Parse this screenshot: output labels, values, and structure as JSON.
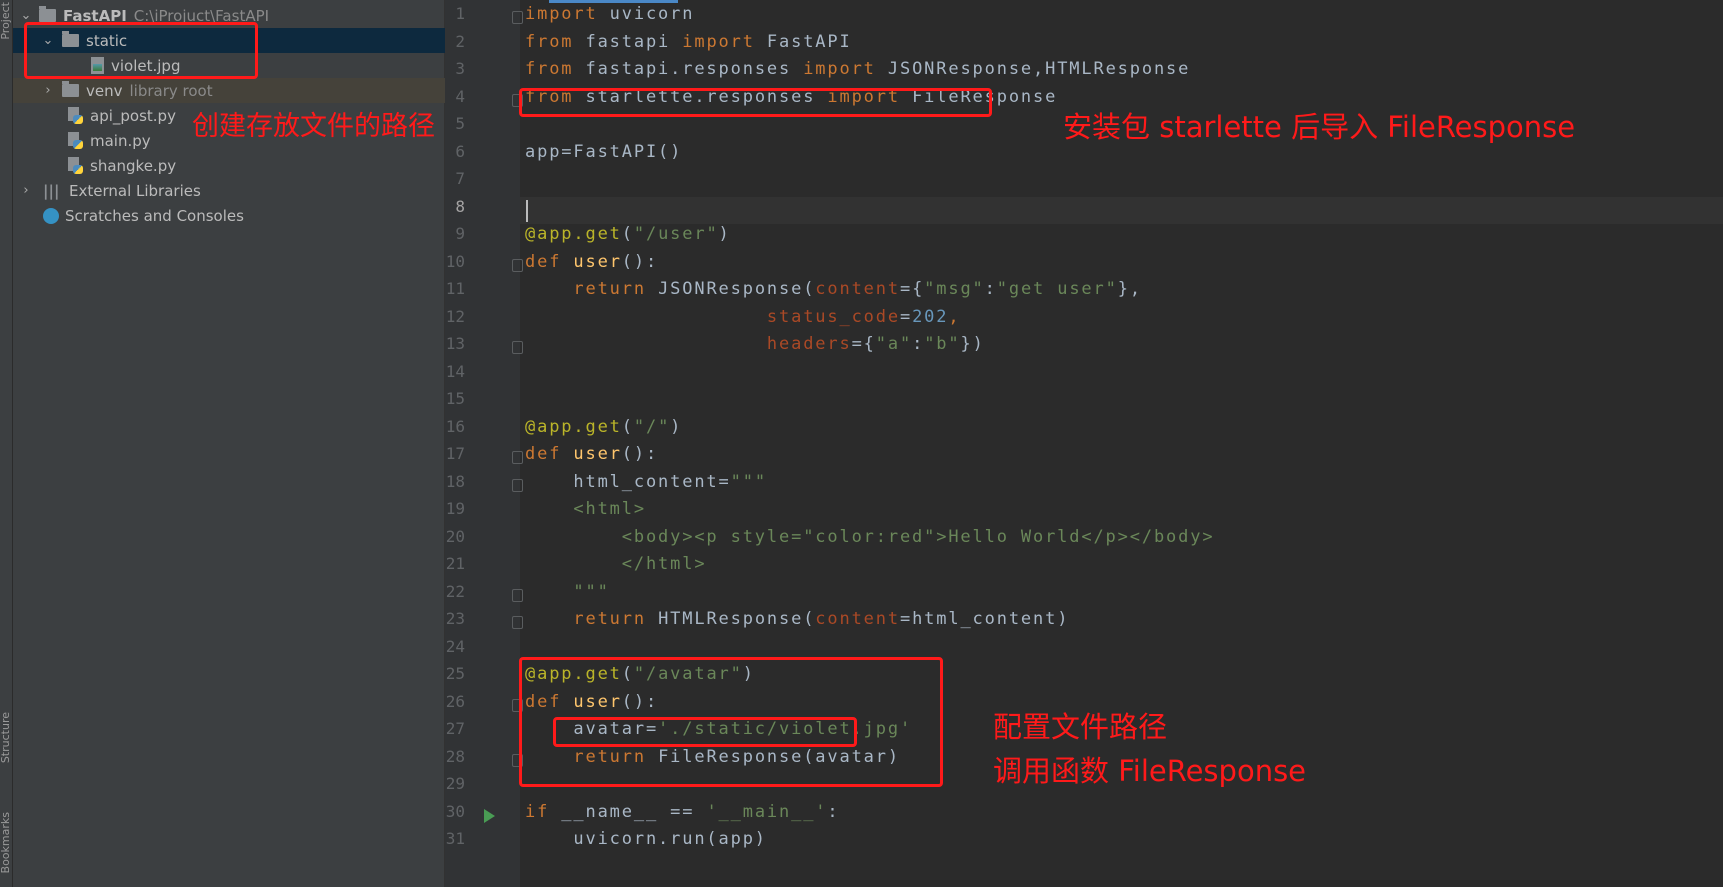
{
  "side_strip": {
    "top_label": "Project",
    "structure_label": "Structure",
    "bookmarks_label": "Bookmarks"
  },
  "project_tree": {
    "root": {
      "name": "FastAPI",
      "path": "C:\\iProjuct\\FastAPI"
    },
    "items": [
      {
        "name": "static",
        "type": "folder",
        "expanded": true
      },
      {
        "name": "violet.jpg",
        "type": "image"
      },
      {
        "name": "venv",
        "type": "folder",
        "hint": "library root"
      },
      {
        "name": "api_post.py",
        "type": "python"
      },
      {
        "name": "main.py",
        "type": "python"
      },
      {
        "name": "shangke.py",
        "type": "python"
      },
      {
        "name": "External Libraries",
        "type": "libraries"
      },
      {
        "name": "Scratches and Consoles",
        "type": "scratches"
      }
    ]
  },
  "editor": {
    "current_line": 8,
    "lines": [
      [
        [
          "kw",
          "import"
        ],
        [
          "pl",
          " uvicorn"
        ]
      ],
      [
        [
          "kw",
          "from"
        ],
        [
          "pl",
          " fastapi "
        ],
        [
          "kw",
          "import"
        ],
        [
          "pl",
          " FastAPI"
        ]
      ],
      [
        [
          "kw",
          "from"
        ],
        [
          "pl",
          " fastapi.responses "
        ],
        [
          "kw",
          "import"
        ],
        [
          "pl",
          " JSONResponse,HTMLResponse"
        ]
      ],
      [
        [
          "kw",
          "from"
        ],
        [
          "pl",
          " starlette.responses "
        ],
        [
          "kw",
          "import"
        ],
        [
          "pl",
          " FileResponse"
        ]
      ],
      [],
      [
        [
          "pl",
          "app=FastAPI()"
        ]
      ],
      [],
      [],
      [
        [
          "deco",
          "@app.get"
        ],
        [
          "pl",
          "("
        ],
        [
          "str",
          "\"/user\""
        ],
        [
          "pl",
          ")"
        ]
      ],
      [
        [
          "kw",
          "def"
        ],
        [
          "pl",
          " "
        ],
        [
          "fn",
          "user"
        ],
        [
          "pl",
          "():"
        ]
      ],
      [
        [
          "pl",
          "    "
        ],
        [
          "kw",
          "return"
        ],
        [
          "pl",
          " JSONResponse("
        ],
        [
          "param",
          "content"
        ],
        [
          "pl",
          "={"
        ],
        [
          "str",
          "\"msg\""
        ],
        [
          "pl",
          ":"
        ],
        [
          "str",
          "\"get user\""
        ],
        [
          "pl",
          "},"
        ]
      ],
      [
        [
          "pl",
          "                    "
        ],
        [
          "param",
          "status_code"
        ],
        [
          "pl",
          "="
        ],
        [
          "num",
          "202"
        ],
        [
          "kw",
          ","
        ]
      ],
      [
        [
          "pl",
          "                    "
        ],
        [
          "param",
          "headers"
        ],
        [
          "pl",
          "={"
        ],
        [
          "str",
          "\"a\""
        ],
        [
          "pl",
          ":"
        ],
        [
          "str",
          "\"b\""
        ],
        [
          "pl",
          "})"
        ]
      ],
      [],
      [],
      [
        [
          "deco",
          "@app.get"
        ],
        [
          "pl",
          "("
        ],
        [
          "str",
          "\"/\""
        ],
        [
          "pl",
          ")"
        ]
      ],
      [
        [
          "kw",
          "def"
        ],
        [
          "pl",
          " "
        ],
        [
          "fn",
          "user"
        ],
        [
          "pl",
          "():"
        ]
      ],
      [
        [
          "pl",
          "    html_content="
        ],
        [
          "str",
          "\"\"\""
        ]
      ],
      [
        [
          "pl",
          "    "
        ],
        [
          "str",
          "<html>"
        ]
      ],
      [
        [
          "pl",
          "        "
        ],
        [
          "str",
          "<body><p style=\"color:red\">Hello World</p></body>"
        ]
      ],
      [
        [
          "pl",
          "        "
        ],
        [
          "str",
          "</html>"
        ]
      ],
      [
        [
          "pl",
          "    "
        ],
        [
          "str",
          "\"\"\""
        ]
      ],
      [
        [
          "pl",
          "    "
        ],
        [
          "kw",
          "return"
        ],
        [
          "pl",
          " HTMLResponse("
        ],
        [
          "param",
          "content"
        ],
        [
          "pl",
          "=html_content)"
        ]
      ],
      [],
      [
        [
          "deco",
          "@app.get"
        ],
        [
          "pl",
          "("
        ],
        [
          "str",
          "\"/avatar\""
        ],
        [
          "pl",
          ")"
        ]
      ],
      [
        [
          "kw",
          "def"
        ],
        [
          "pl",
          " "
        ],
        [
          "fn",
          "user"
        ],
        [
          "pl",
          "():"
        ]
      ],
      [
        [
          "pl",
          "    avatar="
        ],
        [
          "str",
          "'./static/violet.jpg'"
        ]
      ],
      [
        [
          "pl",
          "    "
        ],
        [
          "kw",
          "return"
        ],
        [
          "pl",
          " FileResponse(avatar)"
        ]
      ],
      [],
      [
        [
          "kw",
          "if"
        ],
        [
          "pl",
          " __name__ == "
        ],
        [
          "str",
          "'__main__'"
        ],
        [
          "pl",
          ":"
        ]
      ],
      [
        [
          "pl",
          "    uvicorn.run(app)"
        ]
      ]
    ]
  },
  "annotations": {
    "tree_note": "创建存放文件的路径",
    "import_note": "安装包 starlette 后导入 FileResponse",
    "path_note_1": "配置文件路径",
    "path_note_2": "调用函数 FileResponse",
    "color": "#ff1a1a"
  },
  "colors": {
    "keyword": "#cc7832",
    "string": "#6a8759",
    "number": "#6897bb",
    "decorator": "#bbb529",
    "param": "#aa4926",
    "function": "#ffc66d",
    "text": "#a9b7c6",
    "selection": "#0d293e",
    "run_icon": "#499c54"
  }
}
